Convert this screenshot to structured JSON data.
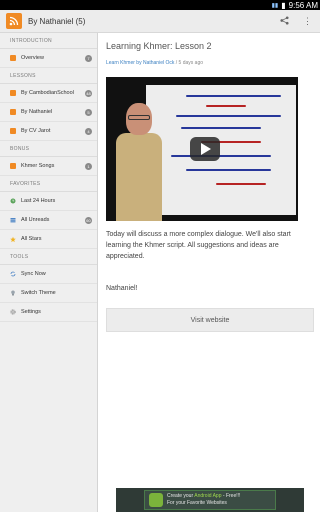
{
  "status": {
    "time": "9:56 AM"
  },
  "actionbar": {
    "title": "By Nathaniel (5)",
    "share_label": "⇪",
    "menu_label": "⋮"
  },
  "sidebar": {
    "introduction": {
      "header": "INTRODUCTION",
      "items": [
        {
          "label": "Overview",
          "badge": "7"
        }
      ]
    },
    "lessons": {
      "header": "LESSONS",
      "items": [
        {
          "label": "By CambodianSchool",
          "badge": "48"
        },
        {
          "label": "By Nathaniel",
          "badge": "5"
        },
        {
          "label": "By CV Jarot",
          "badge": "4"
        }
      ]
    },
    "bonus": {
      "header": "BONUS",
      "items": [
        {
          "label": "Khmer Songs",
          "badge": "1"
        }
      ]
    },
    "favorites": {
      "header": "FAVORITES",
      "items": [
        {
          "label": "Last 24 Hours",
          "badge": ""
        },
        {
          "label": "All Unreads",
          "badge": "60"
        },
        {
          "label": "All Stars",
          "badge": ""
        }
      ]
    },
    "tools": {
      "header": "TOOLS",
      "items": [
        {
          "label": "Sync Now"
        },
        {
          "label": "Switch Theme"
        },
        {
          "label": "Settings"
        }
      ]
    }
  },
  "article": {
    "title": "Learning Khmer: Lesson 2",
    "source": "Learn Khmer by Nathaniel Ock",
    "age": "5 days ago",
    "body": "Today will discuss a more complex dialogue. We'll also start learning the Khmer script. All suggestions and ideas are appreciated.",
    "signature": "Nathaniel!",
    "visit_label": "Visit website"
  },
  "ad": {
    "line1_a": "Create your ",
    "line1_b": "Android App",
    "line1_c": " - Free!!!",
    "line2": "For your Favorite Websites"
  },
  "colors": {
    "accent": "#f08a24",
    "link": "#3a7fc1"
  }
}
